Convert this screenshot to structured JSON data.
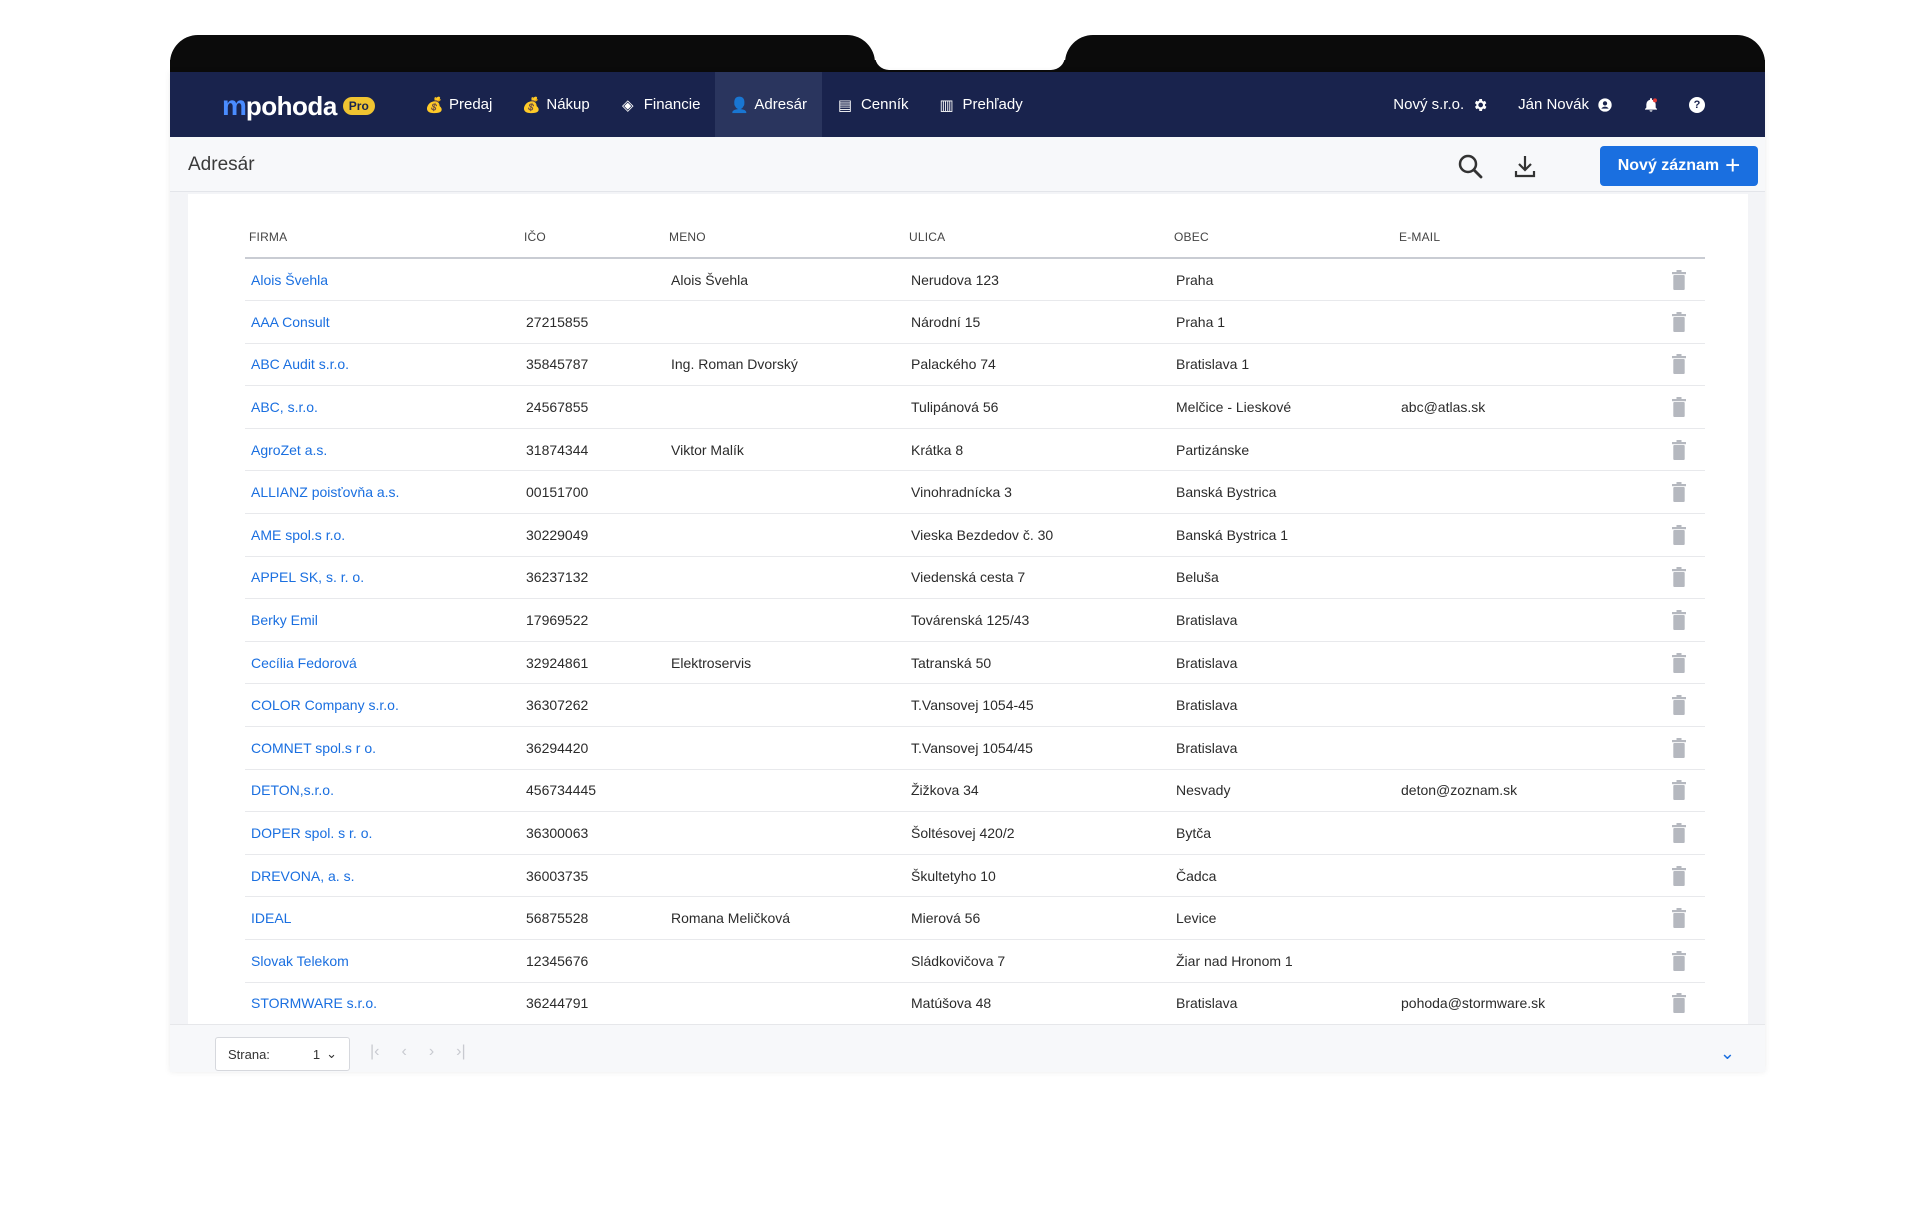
{
  "brand": {
    "mark": "m",
    "name": "pohoda",
    "badge": "Pro"
  },
  "nav": {
    "items": [
      {
        "label": "Predaj",
        "icon": "sales-icon",
        "glyph": "💰"
      },
      {
        "label": "Nákup",
        "icon": "purchase-icon",
        "glyph": "💰"
      },
      {
        "label": "Financie",
        "icon": "finance-icon",
        "glyph": "◈"
      },
      {
        "label": "Adresár",
        "icon": "person-icon",
        "glyph": "👤"
      },
      {
        "label": "Cenník",
        "icon": "pricelist-icon",
        "glyph": "▤"
      },
      {
        "label": "Prehľady",
        "icon": "chart-icon",
        "glyph": "▥"
      }
    ],
    "active": "Adresár",
    "org": "Nový s.r.o.",
    "user": "Ján Novák"
  },
  "header": {
    "title": "Adresár",
    "new_button": "Nový záznam"
  },
  "table": {
    "columns": [
      "FIRMA",
      "IČO",
      "MENO",
      "ULICA",
      "OBEC",
      "E-MAIL"
    ],
    "rows": [
      [
        "Alois Švehla",
        "",
        "Alois Švehla",
        "Nerudova 123",
        "Praha",
        ""
      ],
      [
        "AAA Consult",
        "27215855",
        "",
        "Národní 15",
        "Praha 1",
        ""
      ],
      [
        "ABC Audit s.r.o.",
        "35845787",
        "Ing. Roman Dvorský",
        "Palackého 74",
        "Bratislava 1",
        ""
      ],
      [
        "ABC, s.r.o.",
        "24567855",
        "",
        "Tulipánová 56",
        "Melčice - Lieskové",
        "abc@atlas.sk"
      ],
      [
        "AgroZet a.s.",
        "31874344",
        "Viktor Malík",
        "Krátka 8",
        "Partizánske",
        ""
      ],
      [
        "ALLIANZ poisťovňa a.s.",
        "00151700",
        "",
        "Vinohradnícka 3",
        "Banská Bystrica",
        ""
      ],
      [
        "AME spol.s r.o.",
        "30229049",
        "",
        "Vieska Bezdedov č. 30",
        "Banská Bystrica 1",
        ""
      ],
      [
        "APPEL SK, s. r. o.",
        "36237132",
        "",
        "Viedenská cesta 7",
        "Beluša",
        ""
      ],
      [
        "Berky Emil",
        "17969522",
        "",
        "Továrenská 125/43",
        "Bratislava",
        ""
      ],
      [
        "Cecília Fedorová",
        "32924861",
        "Elektroservis",
        "Tatranská 50",
        "Bratislava",
        ""
      ],
      [
        "COLOR Company s.r.o.",
        "36307262",
        "",
        "T.Vansovej 1054-45",
        "Bratislava",
        ""
      ],
      [
        "COMNET spol.s r o.",
        "36294420",
        "",
        "T.Vansovej 1054/45",
        "Bratislava",
        ""
      ],
      [
        "DETON,s.r.o.",
        "456734445",
        "",
        "Žižkova 34",
        "Nesvady",
        "deton@zoznam.sk"
      ],
      [
        "DOPER spol. s r. o.",
        "36300063",
        "",
        "Šoltésovej 420/2",
        "Bytča",
        ""
      ],
      [
        "DREVONA, a. s.",
        "36003735",
        "",
        "Škultetyho 10",
        "Čadca",
        ""
      ],
      [
        "IDEAL",
        "56875528",
        "Romana Meličková",
        "Mierová 56",
        "Levice",
        ""
      ],
      [
        "Slovak Telekom",
        "12345676",
        "",
        "Sládkovičova 7",
        "Žiar nad Hronom 1",
        ""
      ],
      [
        "STORMWARE s.r.o.",
        "36244791",
        "",
        "Matúšova 48",
        "Bratislava",
        "pohoda@stormware.sk"
      ]
    ]
  },
  "pager": {
    "label": "Strana:",
    "value": "1"
  },
  "colors": {
    "navbar": "#19234d",
    "accent": "#1a6fe0",
    "badge": "#f0c431"
  }
}
